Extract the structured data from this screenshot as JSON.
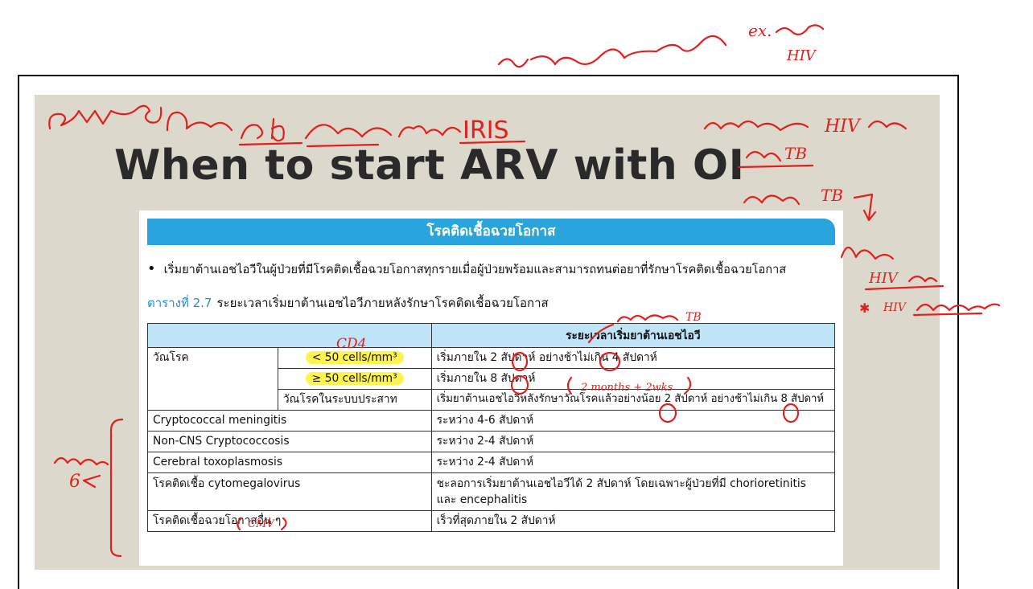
{
  "slide": {
    "title": "When to start ARV with OI"
  },
  "document": {
    "banner_title": "โรคติดเชื้อฉวยโอกาส",
    "bullet_text": "เริ่มยาต้านเอชไอวีในผู้ป่วยที่มีโรคติดเชื้อฉวยโอกาสทุกรายเมื่อผู้ป่วยพร้อมและสามารถทนต่อยาที่รักษาโรคติดเชื้อฉวยโอกาส",
    "caption_number": "ตารางที่ 2.7",
    "caption_text": "ระยะเวลาเริ่มยาต้านเอชไอวีภายหลังรักษาโรคติดเชื้อฉวยโอกาส",
    "table": {
      "header": [
        "",
        "",
        "ระยะเวลาเริ่มยาต้านเอชไอวี"
      ],
      "tb_label": "วัณโรค",
      "tb_rows": [
        {
          "cd4": "< 50 cells/mm³",
          "timing": "เริ่มภายใน 2 สัปดาห์ อย่างช้าไม่เกิน 4 สัปดาห์"
        },
        {
          "cd4": "≥ 50 cells/mm³",
          "timing": "เริ่มภายใน 8 สัปดาห์"
        },
        {
          "cd4": "วัณโรคในระบบประสาท",
          "timing": "เริ่มยาต้านเอชไอวีหลังรักษาวัณโรคแล้วอย่างน้อย 2 สัปดาห์ อย่างช้าไม่เกิน 8 สัปดาห์"
        }
      ],
      "other_rows": [
        {
          "condition": "Cryptococcal meningitis",
          "timing": "ระหว่าง 4-6 สัปดาห์"
        },
        {
          "condition": "Non-CNS Cryptococcosis",
          "timing": "ระหว่าง 2-4 สัปดาห์"
        },
        {
          "condition": "Cerebral toxoplasmosis",
          "timing": "ระหว่าง 2-4 สัปดาห์"
        },
        {
          "condition": "โรคติดเชื้อ cytomegalovirus",
          "timing": "ชะลอการเริ่มยาต้านเอชไอวีได้ 2 สัปดาห์ โดยเฉพาะผู้ป่วยที่มี chorioretinitis และ encephalitis"
        },
        {
          "condition": "โรคติดเชื้อฉวยโอกาสอื่น ๆ",
          "timing": "เร็วที่สุดภายใน 2 สัปดาห์"
        }
      ]
    }
  },
  "annotations": {
    "top_right": "ex.",
    "top_right_2": "HIV",
    "left_top": "IRIS",
    "cd4_note": "CD4",
    "right_1": "HIV",
    "right_2": "TB",
    "right_3": "TB",
    "right_4": "HIV",
    "right_5": "HIV",
    "rate_note": "2 months + 2wks",
    "cmv_note": "CMV",
    "tb_header_note": "TB",
    "left_note": "6",
    "ink_color": "#e0201e"
  }
}
